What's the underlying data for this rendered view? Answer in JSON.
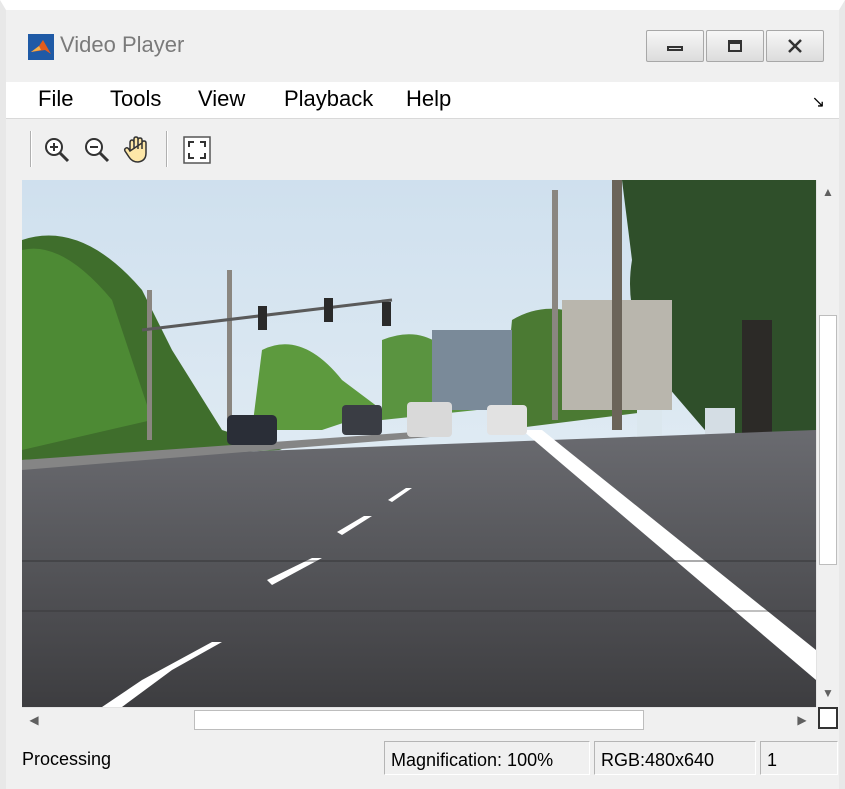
{
  "window": {
    "title": "Video Player",
    "controls": [
      "minimize-icon",
      "maximize-icon",
      "close-icon"
    ]
  },
  "menubar": {
    "items": [
      {
        "label": "File"
      },
      {
        "label": "Tools"
      },
      {
        "label": "View"
      },
      {
        "label": "Playback"
      },
      {
        "label": "Help"
      }
    ],
    "dock_icon": "↘"
  },
  "toolbar": {
    "buttons": [
      "zoom-in-icon",
      "zoom-out-icon",
      "pan-hand-icon",
      "fit-to-view-icon"
    ]
  },
  "viewport": {
    "content": "video-frame-street-scene",
    "colors": {
      "sky": "#dfeaf2",
      "road": "#4f4f52",
      "trees": "#3f6e2c"
    }
  },
  "scrollbars": {
    "vertical": {
      "up_arrow": "▲",
      "down_arrow": "▼"
    },
    "horizontal": {
      "left_arrow": "◀",
      "right_arrow": "▶"
    }
  },
  "status": {
    "text": "Processing",
    "magnification": "Magnification: 100%",
    "image_info": "RGB:480x640",
    "frame": "1"
  }
}
